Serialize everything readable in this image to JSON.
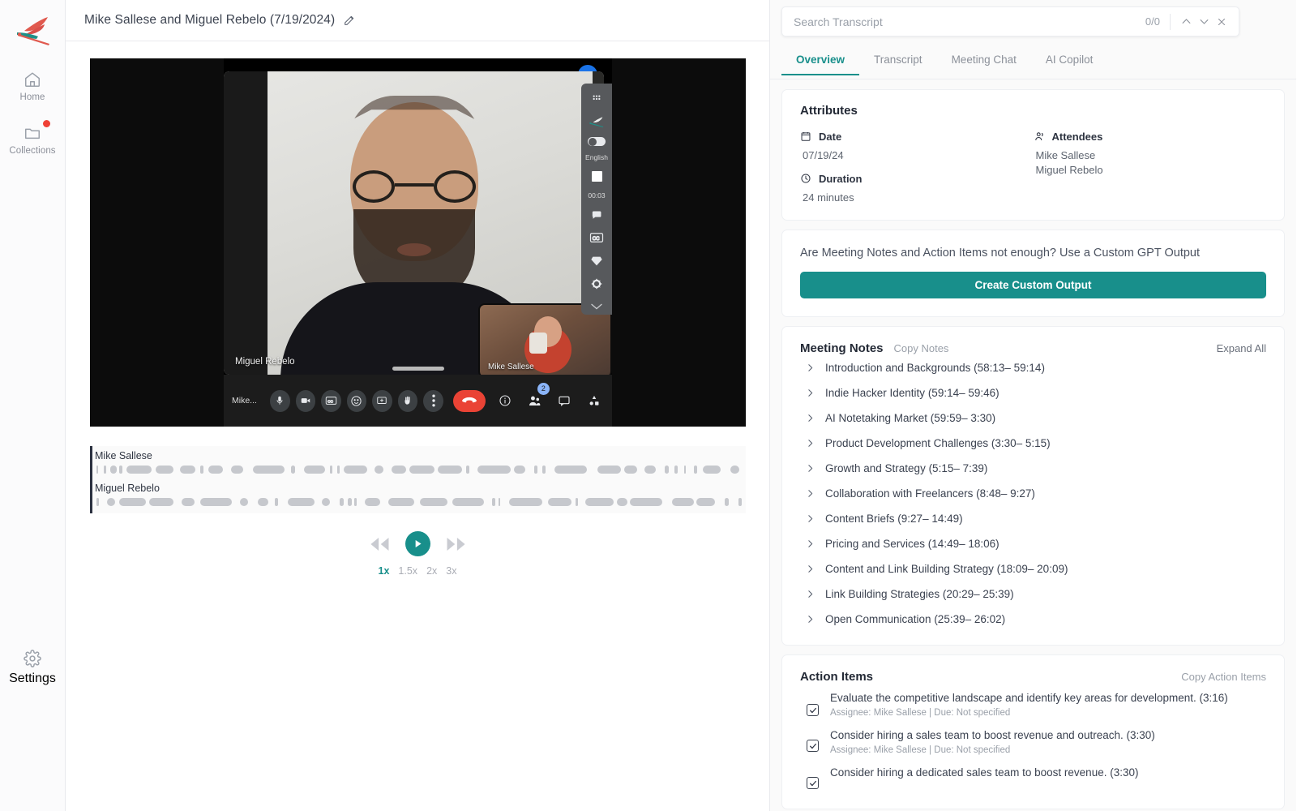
{
  "sidebar": {
    "logo_name": "fireflies-bird-logo",
    "items": [
      {
        "label": "Home",
        "icon": "home-icon"
      },
      {
        "label": "Collections",
        "icon": "folder-icon",
        "badge": true
      }
    ],
    "bottom": {
      "label": "Settings",
      "icon": "gear-icon"
    }
  },
  "header": {
    "title": "Mike Sallese and Miguel Rebelo (7/19/2024)",
    "edit_icon": "edit-pencil-icon"
  },
  "video": {
    "main_speaker_label": "Miguel Rebelo",
    "pip_speaker_label": "Mike Sallese",
    "self_label": "Mike...",
    "participants_badge": "2",
    "side_panel": {
      "language": "English",
      "timer": "00:03"
    },
    "controls": [
      "microphone-icon",
      "camera-icon",
      "closed-captions-icon",
      "emoji-icon",
      "present-screen-icon",
      "raise-hand-icon",
      "more-options-icon",
      "hang-up-icon",
      "meeting-info-icon",
      "people-icon",
      "chat-icon",
      "activities-icon"
    ]
  },
  "waveform": {
    "speakers": [
      {
        "name": "Mike Sallese"
      },
      {
        "name": "Miguel Rebelo"
      }
    ]
  },
  "player": {
    "rewind_icon": "rewind-icon",
    "play_icon": "play-icon",
    "forward_icon": "fast-forward-icon",
    "speeds": [
      "1x",
      "1.5x",
      "2x",
      "3x"
    ],
    "active_speed": "1x"
  },
  "search": {
    "placeholder": "Search Transcript",
    "value": "",
    "count": "0/0",
    "prev_icon": "chevron-up-icon",
    "next_icon": "chevron-down-icon",
    "close_icon": "close-icon"
  },
  "tabs": [
    {
      "label": "Overview",
      "active": true
    },
    {
      "label": "Transcript",
      "active": false
    },
    {
      "label": "Meeting Chat",
      "active": false
    },
    {
      "label": "AI Copilot",
      "active": false
    }
  ],
  "attributes": {
    "title": "Attributes",
    "date_label": "Date",
    "date_value": "07/19/24",
    "duration_label": "Duration",
    "duration_value": "24 minutes",
    "attendees_label": "Attendees",
    "attendees": [
      "Mike Sallese",
      "Miguel Rebelo"
    ]
  },
  "custom_gpt": {
    "text": "Are Meeting Notes and Action Items not enough? Use a Custom GPT Output",
    "button": "Create Custom Output"
  },
  "meeting_notes": {
    "title": "Meeting Notes",
    "copy_label": "Copy Notes",
    "expand_label": "Expand All",
    "items": [
      "Introduction and Backgrounds (58:13– 59:14)",
      "Indie Hacker Identity (59:14– 59:46)",
      "AI Notetaking Market (59:59– 3:30)",
      "Product Development Challenges (3:30– 5:15)",
      "Growth and Strategy (5:15– 7:39)",
      "Collaboration with Freelancers (8:48– 9:27)",
      "Content Briefs (9:27– 14:49)",
      "Pricing and Services (14:49– 18:06)",
      "Content and Link Building Strategy (18:09– 20:09)",
      "Link Building Strategies (20:29– 25:39)",
      "Open Communication (25:39– 26:02)"
    ]
  },
  "action_items": {
    "title": "Action Items",
    "copy_label": "Copy Action Items",
    "items": [
      {
        "text": "Evaluate the competitive landscape and identify key areas for development. (3:16)",
        "meta": "Assignee: Mike Sallese | Due: Not specified",
        "checked": true
      },
      {
        "text": "Consider hiring a sales team to boost revenue and outreach. (3:30)",
        "meta": "Assignee: Mike Sallese | Due: Not specified",
        "checked": true
      },
      {
        "text": "Consider hiring a dedicated sales team to boost revenue. (3:30)",
        "meta": "",
        "checked": true
      }
    ]
  },
  "colors": {
    "accent": "#188f8b",
    "badge_red": "#ef4136",
    "hangup_red": "#ea4335",
    "panel_bg": "#fafafa"
  }
}
